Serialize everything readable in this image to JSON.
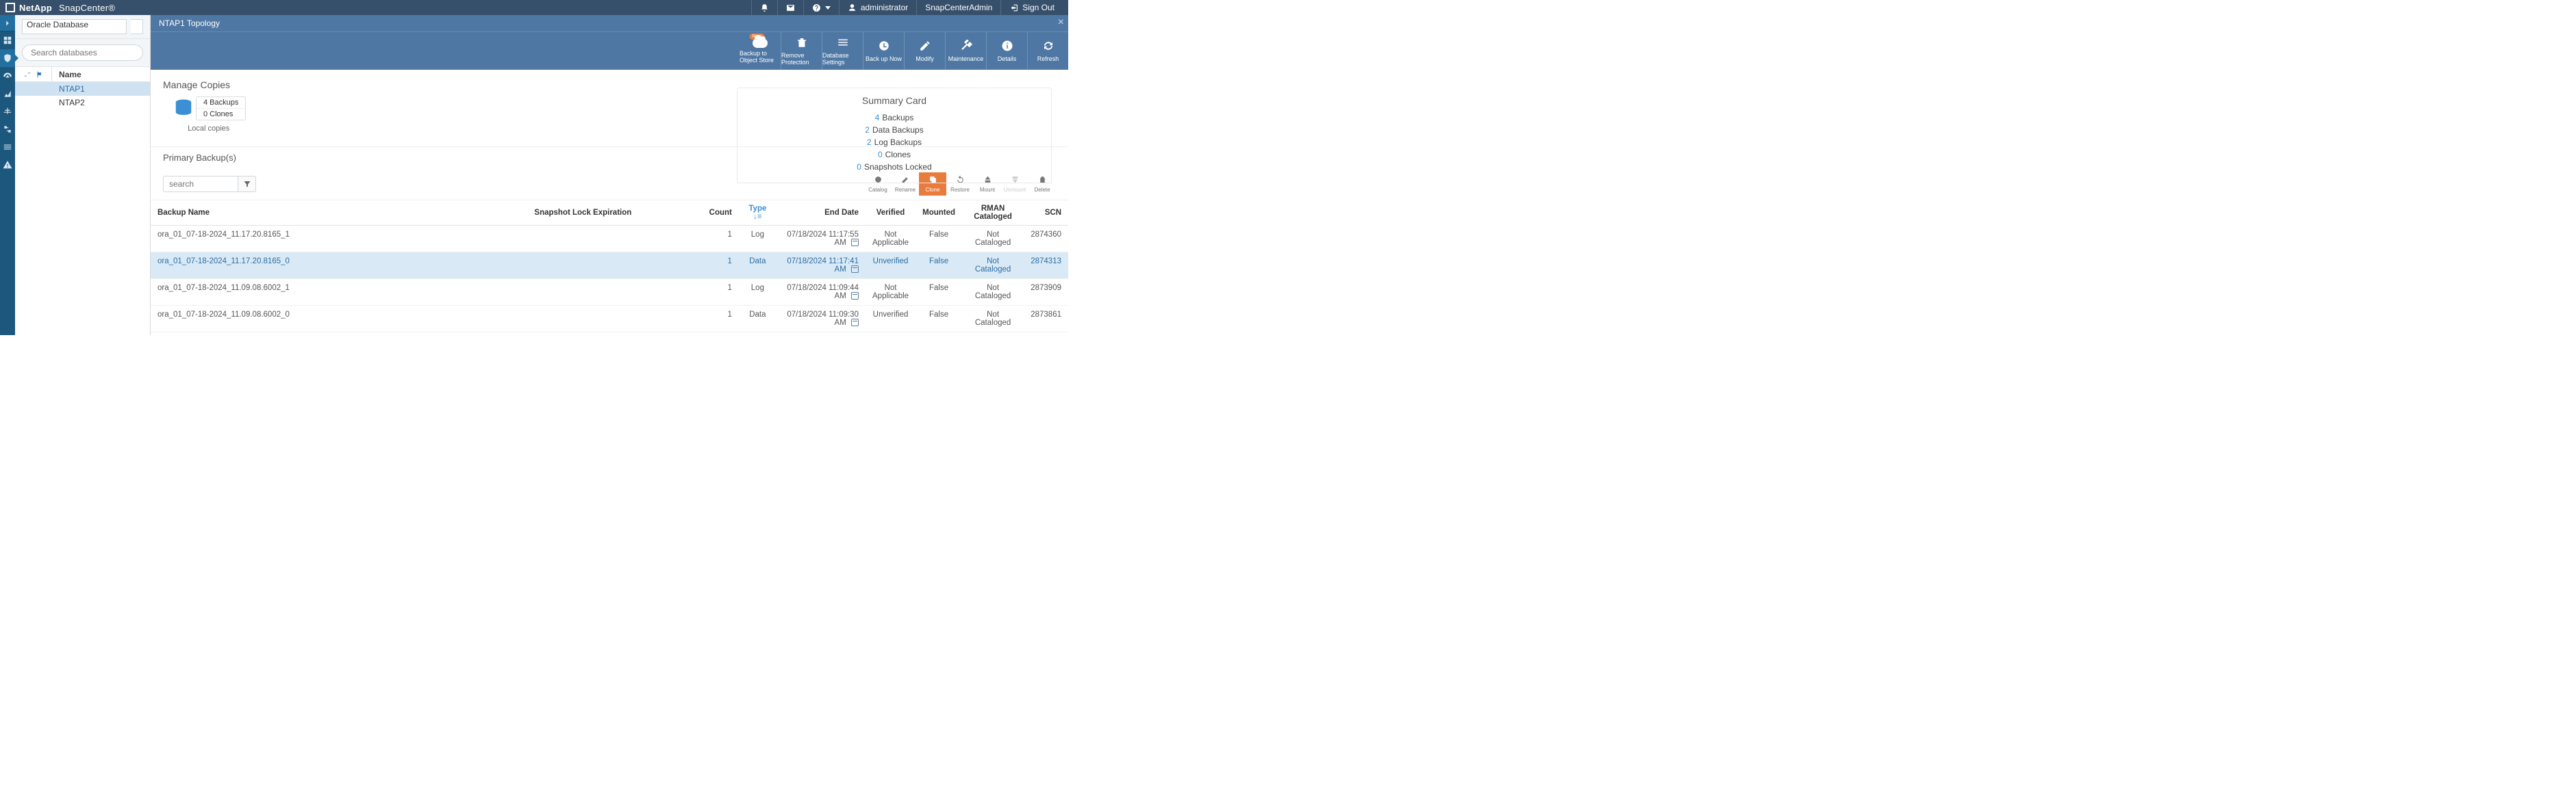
{
  "brand": {
    "company": "NetApp",
    "product": "SnapCenter®"
  },
  "topbar": {
    "user": "administrator",
    "role": "SnapCenterAdmin",
    "signout": "Sign Out"
  },
  "sidebar": {
    "dropdown_value": "Oracle Database",
    "search_placeholder": "Search databases",
    "name_col": "Name",
    "items": [
      {
        "label": "NTAP1",
        "selected": true
      },
      {
        "label": "NTAP2",
        "selected": false
      }
    ]
  },
  "banner": {
    "title": "NTAP1 Topology"
  },
  "actions": [
    {
      "key": "backup_obj",
      "label": "Backup to Object Store",
      "new": true
    },
    {
      "key": "remove_protection",
      "label": "Remove Protection"
    },
    {
      "key": "db_settings",
      "label": "Database Settings"
    },
    {
      "key": "backup_now",
      "label": "Back up Now"
    },
    {
      "key": "modify",
      "label": "Modify"
    },
    {
      "key": "maintenance",
      "label": "Maintenance"
    },
    {
      "key": "details",
      "label": "Details"
    },
    {
      "key": "refresh",
      "label": "Refresh"
    }
  ],
  "manage_copies": {
    "title": "Manage Copies",
    "local": {
      "backups": "4 Backups",
      "clones": "0 Clones",
      "label": "Local copies"
    }
  },
  "summary": {
    "title": "Summary Card",
    "lines": [
      {
        "n": "4",
        "t": "Backups"
      },
      {
        "n": "2",
        "t": "Data Backups"
      },
      {
        "n": "2",
        "t": "Log Backups"
      },
      {
        "n": "0",
        "t": "Clones"
      },
      {
        "n": "0",
        "t": "Snapshots Locked"
      }
    ]
  },
  "primary": {
    "title": "Primary Backup(s)",
    "search_placeholder": "search",
    "row_actions": [
      {
        "label": "Catalog",
        "state": ""
      },
      {
        "label": "Rename",
        "state": ""
      },
      {
        "label": "Clone",
        "state": "active"
      },
      {
        "label": "Restore",
        "state": ""
      },
      {
        "label": "Mount",
        "state": ""
      },
      {
        "label": "Unmount",
        "state": "disabled"
      },
      {
        "label": "Delete",
        "state": ""
      }
    ],
    "columns": {
      "backup_name": "Backup Name",
      "snap_lock": "Snapshot Lock Expiration",
      "count": "Count",
      "type": "Type",
      "end_date": "End Date",
      "verified": "Verified",
      "mounted": "Mounted",
      "rman": "RMAN Cataloged",
      "scn": "SCN"
    },
    "rows": [
      {
        "name": "ora_01_07-18-2024_11.17.20.8165_1",
        "snap": "",
        "count": "1",
        "type": "Log",
        "end": "07/18/2024 11:17:55 AM",
        "verified": "Not Applicable",
        "mounted": "False",
        "rman": "Not Cataloged",
        "scn": "2874360",
        "sel": false
      },
      {
        "name": "ora_01_07-18-2024_11.17.20.8165_0",
        "snap": "",
        "count": "1",
        "type": "Data",
        "end": "07/18/2024 11:17:41 AM",
        "verified": "Unverified",
        "mounted": "False",
        "rman": "Not Cataloged",
        "scn": "2874313",
        "sel": true
      },
      {
        "name": "ora_01_07-18-2024_11.09.08.6002_1",
        "snap": "",
        "count": "1",
        "type": "Log",
        "end": "07/18/2024 11:09:44 AM",
        "verified": "Not Applicable",
        "mounted": "False",
        "rman": "Not Cataloged",
        "scn": "2873909",
        "sel": false
      },
      {
        "name": "ora_01_07-18-2024_11.09.08.6002_0",
        "snap": "",
        "count": "1",
        "type": "Data",
        "end": "07/18/2024 11:09:30 AM",
        "verified": "Unverified",
        "mounted": "False",
        "rman": "Not Cataloged",
        "scn": "2873861",
        "sel": false
      }
    ]
  }
}
